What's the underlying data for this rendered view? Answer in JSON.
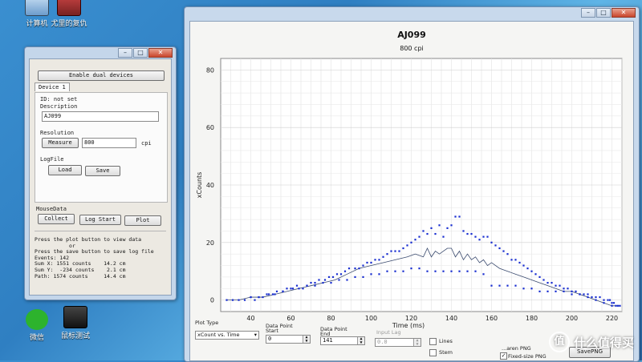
{
  "desktop": {
    "icons": [
      {
        "label": "计算机",
        "icon": "computer-icon"
      },
      {
        "label": "尤里的复仇",
        "icon": "game-shortcut-icon"
      },
      {
        "label": "微信",
        "icon": "wechat-icon"
      },
      {
        "label": "鼠标测试",
        "icon": "mouse-tester-icon"
      }
    ],
    "watermark": "什么值得买"
  },
  "small_window": {
    "enable_dual_button": "Enable dual devices",
    "tab": "Device 1",
    "id_text": "ID: not set",
    "description_label": "Description",
    "description_value": "AJ099",
    "resolution_label": "Resolution",
    "measure_button": "Measure",
    "resolution_value": "800",
    "resolution_unit": "cpi",
    "logfile_label": "LogFile",
    "load_button": "Load",
    "save_button": "Save",
    "mousedata_label": "MouseData",
    "collect_button": "Collect",
    "logstart_button": "Log Start",
    "plot_button": "Plot",
    "info_text": "Press the plot button to view data\n           or\nPress the save button to save log file\nEvents: 142\nSum X: 1551 counts    14.2 cm\nSum Y:  -234 counts    2.1 cm\nPath: 1574 counts     14.4 cm"
  },
  "big_window": {
    "window_controls": [
      "minimize",
      "maximize",
      "close"
    ],
    "plot_type_label": "Plot Type",
    "plot_type_value": "xCount vs. Time",
    "data_point_start_label": "Data Point\nStart",
    "data_point_start_value": "0",
    "data_point_end_label": "Data Point\nEnd",
    "data_point_end_value": "141",
    "input_lag_label": "Input Lag",
    "input_lag_value": "0.0",
    "lines_label": "Lines",
    "stem_label": "Stem",
    "transparent_png_label": "...aren PNG",
    "fixed_png_label": "Fixed-size PNG",
    "save_png_button": "SavePNG"
  },
  "chart_data": {
    "type": "scatter",
    "title": "AJ099",
    "subtitle": "800 cpi",
    "xlabel": "Time (ms)",
    "ylabel": "xCounts",
    "xlim": [
      25,
      225
    ],
    "ylim": [
      -4,
      84
    ],
    "xticks": [
      40,
      60,
      80,
      100,
      120,
      140,
      160,
      180,
      200,
      220
    ],
    "yticks": [
      0,
      20,
      40,
      60,
      80
    ],
    "grid": true,
    "colors": {
      "points": "#1a2fd0",
      "line": "#3a4a6e"
    },
    "series": [
      {
        "type": "scatter",
        "x": [
          28,
          31,
          34,
          37,
          40,
          42,
          44,
          46,
          49,
          51,
          53,
          56,
          58,
          61,
          63,
          66,
          68,
          70,
          72,
          74,
          77,
          79,
          81,
          83,
          85,
          87,
          89,
          92,
          94,
          96,
          98,
          100,
          102,
          104,
          106,
          108,
          110,
          112,
          114,
          116,
          118,
          120,
          122,
          124,
          126,
          128,
          130,
          132,
          134,
          136,
          138,
          140,
          142,
          144,
          146,
          148,
          150,
          152,
          154,
          156,
          158,
          160,
          162,
          164,
          166,
          168,
          170,
          172,
          174,
          176,
          178,
          180,
          182,
          184,
          186,
          188,
          190,
          192,
          194,
          196,
          198,
          200,
          202,
          204,
          206,
          208,
          210,
          212,
          214,
          216,
          218,
          219,
          220,
          221,
          222,
          223,
          224,
          40,
          44,
          48,
          52,
          56,
          60,
          64,
          68,
          72,
          76,
          80,
          84,
          88,
          92,
          96,
          100,
          104,
          108,
          112,
          116,
          120,
          124,
          128,
          132,
          136,
          140,
          144,
          148,
          152,
          156,
          160,
          164,
          168,
          172,
          176,
          180,
          184,
          188,
          192,
          196,
          200,
          204,
          208,
          212,
          216,
          220
        ],
        "y": [
          0,
          0,
          0,
          0,
          1,
          0,
          1,
          1,
          2,
          2,
          3,
          3,
          4,
          4,
          5,
          4,
          5,
          6,
          6,
          7,
          7,
          8,
          8,
          9,
          9,
          10,
          11,
          11,
          11,
          12,
          13,
          13,
          14,
          14,
          15,
          16,
          17,
          17,
          17,
          18,
          19,
          20,
          21,
          22,
          24,
          23,
          25,
          23,
          26,
          22,
          25,
          26,
          29,
          29,
          24,
          23,
          23,
          22,
          21,
          22,
          22,
          20,
          19,
          18,
          17,
          16,
          14,
          14,
          13,
          12,
          11,
          10,
          9,
          8,
          7,
          6,
          6,
          5,
          5,
          4,
          4,
          3,
          3,
          2,
          2,
          2,
          1,
          1,
          1,
          0,
          0,
          0,
          -1,
          -1,
          -2,
          -2,
          -2,
          1,
          1,
          2,
          2,
          3,
          4,
          4,
          5,
          5,
          6,
          6,
          7,
          7,
          8,
          8,
          9,
          9,
          10,
          10,
          10,
          11,
          11,
          10,
          10,
          10,
          10,
          10,
          10,
          10,
          9,
          5,
          5,
          5,
          5,
          4,
          4,
          3,
          3,
          3,
          3,
          2,
          2,
          1,
          0,
          -1,
          -2
        ]
      },
      {
        "type": "line",
        "x": [
          28,
          34,
          40,
          46,
          52,
          58,
          64,
          70,
          76,
          82,
          88,
          94,
          100,
          106,
          112,
          118,
          122,
          126,
          128,
          130,
          132,
          134,
          136,
          138,
          140,
          142,
          144,
          146,
          148,
          150,
          152,
          154,
          156,
          158,
          160,
          164,
          168,
          172,
          176,
          180,
          184,
          188,
          192,
          196,
          200,
          204,
          208,
          212,
          216,
          220,
          224
        ],
        "y": [
          0,
          0,
          1,
          1,
          2,
          3,
          4,
          5,
          6,
          7,
          9,
          11,
          12,
          13,
          14,
          15,
          16,
          15,
          18,
          15,
          17,
          16,
          17,
          18,
          18,
          15,
          17,
          14,
          16,
          14,
          15,
          13,
          14,
          12,
          13,
          11,
          10,
          9,
          8,
          7,
          6,
          5,
          4,
          3,
          3,
          2,
          1,
          0,
          -1,
          -2,
          -2
        ]
      }
    ]
  }
}
